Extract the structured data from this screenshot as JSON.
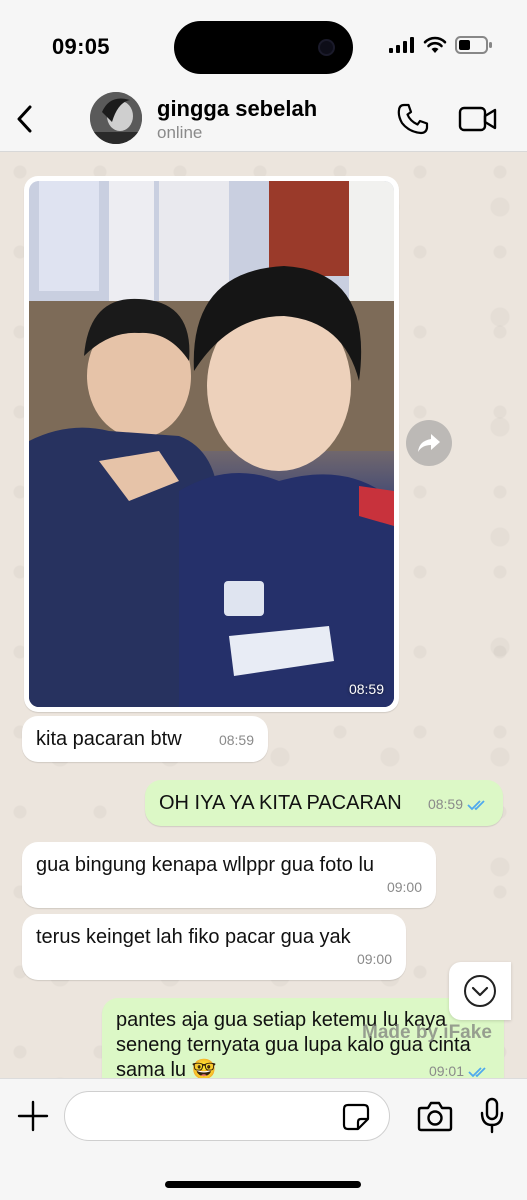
{
  "status_bar": {
    "time": "09:05"
  },
  "header": {
    "name": "gingga sebelah",
    "status": "online"
  },
  "photo_message": {
    "time": "08:59"
  },
  "messages": [
    {
      "text": "kita pacaran btw",
      "time": "08:59"
    },
    {
      "text": "OH IYA YA KITA PACARAN",
      "time": "08:59"
    },
    {
      "text": "gua bingung kenapa wllppr gua foto lu",
      "time": "09:00"
    },
    {
      "text": "terus keinget lah fiko pacar gua yak",
      "time": "09:00"
    },
    {
      "text": "pantes aja gua setiap ketemu lu kaya seneng ternyata gua lupa kalo gua cinta sama lu 🤓",
      "time": "09:01"
    }
  ],
  "watermark": "Made by iFake",
  "composer": {
    "placeholder": ""
  },
  "colors": {
    "outgoing_bubble": "#dcf8c6",
    "incoming_bubble": "#ffffff",
    "read_tick": "#4fa9ee",
    "chat_bg": "#ece5dd"
  }
}
